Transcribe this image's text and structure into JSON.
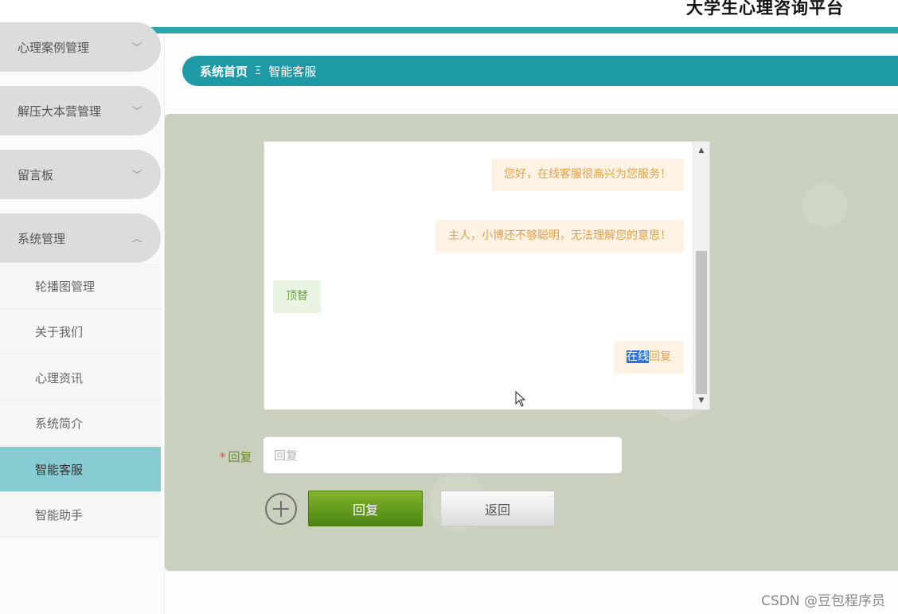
{
  "app": {
    "title": "大学生心理咨询平台"
  },
  "sidebar": {
    "menus": [
      {
        "label": "心理案例管理",
        "chevron": "﹀"
      },
      {
        "label": "解压大本营管理",
        "chevron": "﹀"
      },
      {
        "label": "留言板",
        "chevron": "﹀"
      },
      {
        "label": "系统管理",
        "chevron": "︿"
      }
    ],
    "submenu": [
      {
        "label": "轮播图管理"
      },
      {
        "label": "关于我们"
      },
      {
        "label": "心理资讯"
      },
      {
        "label": "系统简介"
      },
      {
        "label": "智能客服",
        "active": true
      },
      {
        "label": "智能助手"
      }
    ]
  },
  "breadcrumb": {
    "home": "系统首页",
    "separator": "Ξ",
    "current": "智能客服"
  },
  "chat": {
    "messages": [
      {
        "role": "bot",
        "text": "您好，在线客服很高兴为您服务！"
      },
      {
        "role": "bot",
        "text": "主人，小博还不够聪明，无法理解您的意思！"
      },
      {
        "role": "user",
        "text": "顶替"
      },
      {
        "role": "bot",
        "text_highlighted": "在线",
        "text_rest": "回复"
      }
    ]
  },
  "form": {
    "reply_label": "回复",
    "required_mark": "*",
    "reply_placeholder": "回复",
    "reply_value": "",
    "submit_label": "回复",
    "back_label": "返回"
  },
  "watermark": "CSDN @豆包程序员",
  "colors": {
    "accent": "#1d9aa5",
    "active_menu": "#86ccd2",
    "primary_button": "#5e961c"
  }
}
